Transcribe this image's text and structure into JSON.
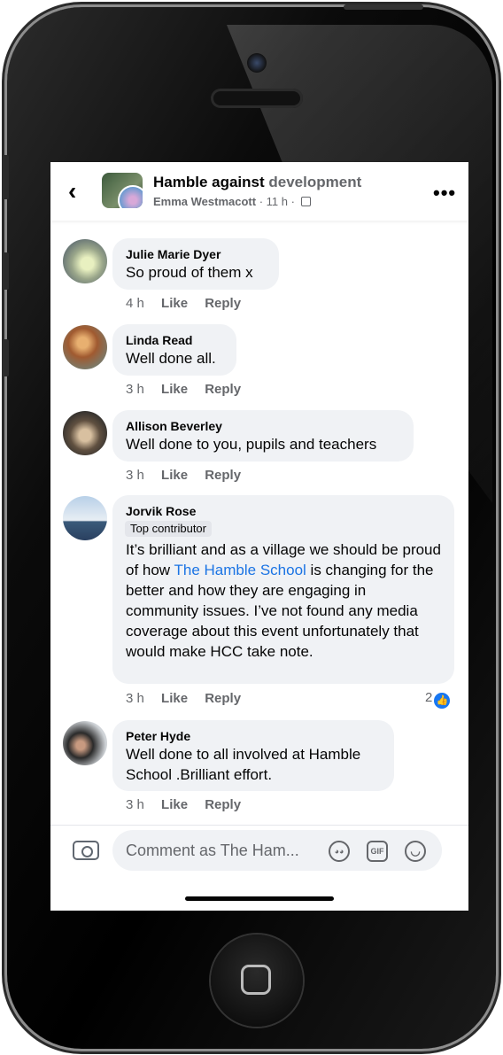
{
  "header": {
    "title_main": "Hamble against",
    "title_rest": "development",
    "author": "Emma Westmacott",
    "time": "· 11 h ·"
  },
  "comments": [
    {
      "author": "Julie Marie Dyer",
      "text": "So proud of them x",
      "time": "4 h",
      "like": "Like",
      "reply": "Reply"
    },
    {
      "author": "Linda Read",
      "text": "Well done all.",
      "time": "3 h",
      "like": "Like",
      "reply": "Reply"
    },
    {
      "author": "Allison Beverley",
      "text": "Well done to you, pupils and teachers",
      "time": "3 h",
      "like": "Like",
      "reply": "Reply"
    },
    {
      "author": "Jorvik Rose",
      "badge": "Top contributor",
      "text_before": "It’s brilliant and as a village we should be proud of how ",
      "text_link": "The Hamble School",
      "text_after": " is changing for the better and how they are engaging in community issues. I’ve not found any media coverage about this event unfortunately that would make HCC take note.",
      "time": "3 h",
      "like": "Like",
      "reply": "Reply",
      "reaction_count": "2"
    },
    {
      "author": "Peter Hyde",
      "text": "Well done to all involved at Hamble School .Brilliant effort.",
      "time": "3 h",
      "like": "Like",
      "reply": "Reply"
    }
  ],
  "footer": {
    "placeholder": "Comment as The Ham...",
    "gif_label": "GIF"
  },
  "icons": {
    "back": "chevron-left-icon",
    "more": "more-options-icon",
    "camera": "camera-icon",
    "avatar_sticker": "sticker-icon",
    "gif": "gif-icon",
    "emoji": "emoji-icon",
    "like": "like-reaction-icon"
  },
  "colors": {
    "link": "#1b74e4",
    "bubble": "#f0f2f5",
    "secondary_text": "#65676b",
    "like_blue": "#1877f2"
  }
}
